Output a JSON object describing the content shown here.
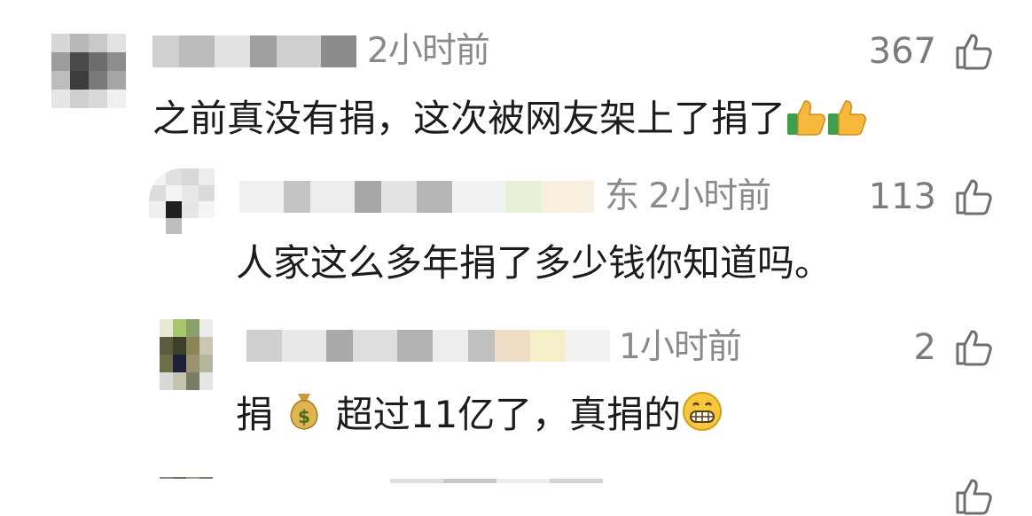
{
  "comments": [
    {
      "time": "2小时前",
      "likes": "367",
      "text_parts": [
        "之前真没有捐，这次被网友架上了捐了"
      ],
      "emojis": [
        "thumbs-up-emoji",
        "thumbs-up-emoji"
      ]
    },
    {
      "name_fragment": "东",
      "time": "2小时前",
      "likes": "113",
      "text_parts": [
        "人家这么多年捐了多少钱你知道吗。"
      ]
    },
    {
      "time": "1小时前",
      "likes": "2",
      "text_parts": [
        "捐",
        "超过11亿了，真捐的"
      ],
      "emojis": [
        "money-bag-emoji",
        "grinning-face-emoji"
      ]
    }
  ],
  "colors": {
    "text": "#1c1c1c",
    "meta": "#8a8a8a",
    "icon": "#6f6f6f"
  }
}
